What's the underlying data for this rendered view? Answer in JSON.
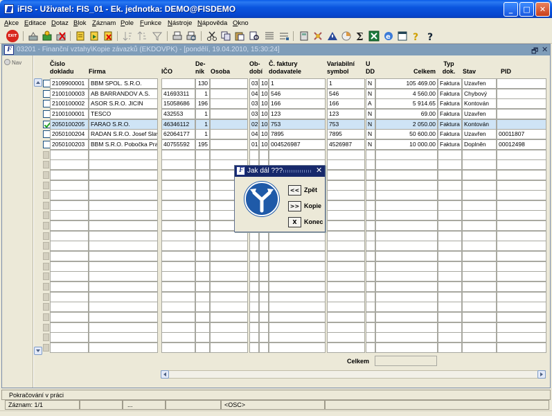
{
  "window": {
    "title": "iFIS - Uživatel: FIS_01 - Ek. jednotka: DEMO@FISDEMO",
    "minimize": "_",
    "maximize": "□",
    "close": "✕"
  },
  "menu": [
    "Akce",
    "Editace",
    "Dotaz",
    "Blok",
    "Záznam",
    "Pole",
    "Funkce",
    "Nástroje",
    "Nápověda",
    "Okno"
  ],
  "toolbar": {
    "exit_label": "EXIT"
  },
  "child": {
    "title": "03201 - Finanční vztahy\\Kopie závazků (EKDOVPK) - [pondělí, 19.04.2010, 15:30:24]",
    "restore": "🗗",
    "close": "✕"
  },
  "nav": {
    "label": "Nav"
  },
  "columns": {
    "cislo": [
      "Číslo",
      "dokladu"
    ],
    "firma": "Firma",
    "ico": "IČO",
    "denik": [
      "De-",
      "ník"
    ],
    "osoba": "Osoba",
    "obdobi": [
      "Ob-",
      "dobí"
    ],
    "faktura": [
      "Č. faktury",
      "dodavatele"
    ],
    "varsymbol": [
      "Variabilní",
      "symbol"
    ],
    "udd": [
      "U",
      "DD"
    ],
    "celkem": "Celkem",
    "typ": [
      "Typ",
      "dok."
    ],
    "stav": "Stav",
    "pid": "PID"
  },
  "rows": [
    {
      "checked": false,
      "cislo": "2109900001",
      "firma": "BBM SPOL. S.R.O.",
      "ico": "",
      "denik": "130",
      "osoba": "",
      "ob1": "03",
      "ob2": "10",
      "faktura": "1",
      "vs": "1",
      "udd": "N",
      "celkem": "105 469.00",
      "typ": "Faktura",
      "stav": "Uzavřen",
      "pid": ""
    },
    {
      "checked": false,
      "cislo": "2100100003",
      "firma": "AB BARRANDOV A.S.",
      "ico": "41693311",
      "denik": "1",
      "osoba": "",
      "ob1": "04",
      "ob2": "10",
      "faktura": "546",
      "vs": "546",
      "udd": "N",
      "celkem": "4 560.00",
      "typ": "Faktura",
      "stav": "Chybový",
      "pid": ""
    },
    {
      "checked": false,
      "cislo": "2100100002",
      "firma": "ASOR S.R.O. JICIN",
      "ico": "15058686",
      "denik": "196",
      "osoba": "",
      "ob1": "03",
      "ob2": "10",
      "faktura": "166",
      "vs": "166",
      "udd": "A",
      "celkem": "5 914.65",
      "typ": "Faktura",
      "stav": "Kontován",
      "pid": ""
    },
    {
      "checked": false,
      "cislo": "2100100001",
      "firma": "TESCO",
      "ico": "432553",
      "denik": "1",
      "osoba": "",
      "ob1": "03",
      "ob2": "10",
      "faktura": "123",
      "vs": "123",
      "udd": "N",
      "celkem": "69.00",
      "typ": "Faktura",
      "stav": "Uzavřen",
      "pid": ""
    },
    {
      "checked": true,
      "cislo": "2050100205",
      "firma": "FARAO S.R.O.",
      "ico": "46346112",
      "denik": "1",
      "osoba": "",
      "ob1": "02",
      "ob2": "10",
      "faktura": "753",
      "vs": "753",
      "udd": "N",
      "celkem": "2 050.00",
      "typ": "Faktura",
      "stav": "Kontován",
      "pid": ""
    },
    {
      "checked": false,
      "cislo": "2050100204",
      "firma": "RADAN S.R.O. Josef Slav",
      "ico": "62064177",
      "denik": "1",
      "osoba": "",
      "ob1": "04",
      "ob2": "10",
      "faktura": "7895",
      "vs": "7895",
      "udd": "N",
      "celkem": "50 600.00",
      "typ": "Faktura",
      "stav": "Uzavřen",
      "pid": "00011807"
    },
    {
      "checked": false,
      "cislo": "2050100203",
      "firma": "BBM S.R.O. Pobočka Prah",
      "ico": "40755592",
      "denik": "195",
      "osoba": "",
      "ob1": "01",
      "ob2": "10",
      "faktura": "004526987",
      "vs": "4526987",
      "udd": "N",
      "celkem": "10 000.00",
      "typ": "Faktura",
      "stav": "Doplněn",
      "pid": "00012498"
    }
  ],
  "footer": {
    "celkem_label": "Celkem"
  },
  "dialog": {
    "title": "Jak dál ???",
    "close": "✕",
    "buttons": [
      {
        "glyph": "<<",
        "label": "Zpět"
      },
      {
        "glyph": ">>",
        "label": "Kopie"
      },
      {
        "glyph": "X",
        "label": "Konec"
      }
    ]
  },
  "status": {
    "message": "Pokračování v práci",
    "record": "Záznam: 1/1",
    "seg3": "...",
    "osc": "<OSC>"
  },
  "colors": {
    "title_blue": "#0a5ce8",
    "selected_row": "#cfe4f6",
    "dialog_title": "#17296b"
  }
}
